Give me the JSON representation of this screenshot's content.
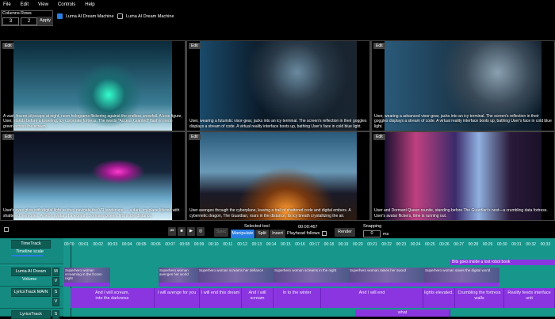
{
  "menu": [
    "File",
    "Edit",
    "View",
    "Controls",
    "Help"
  ],
  "grid_controls": {
    "columns_label": "Columns",
    "rows_label": "Rows",
    "columns": "3",
    "rows": "2",
    "apply": "Apply"
  },
  "checkboxes": [
    {
      "label": "Luma AI Dream Machine",
      "checked": true
    },
    {
      "label": "Luma AI Dream Machine",
      "checked": false
    }
  ],
  "cells": [
    {
      "edit": "Edit",
      "caption": "A vast, frozen cityscape at night, neon holograms flickering against the endless snowfall. A lone figure, User, stands before a towering, icy corporate fortress. The words \"Access Granted\" flash in neon green across the screen."
    },
    {
      "edit": "Edit",
      "caption": "User, wearing a futuristic visor-gear, jacks into an icy terminal. The screen's reflection in their goggles displays a stream of code. A virtual reality interface boots up, bathing User's face in cold blue light."
    },
    {
      "edit": "Edit",
      "caption": "User, wearing a advanced visor-gear, jacks into an icy terminal. The screen's reflection in their goggles displays a stream of code. A virtual reality interface boots up, bathing User's face in cold blue light."
    },
    {
      "edit": "Edit",
      "caption": "User's eyes glow with digital light as they navigate the VR landscape — a dark, icy plane littered with shattered memories. A neon avatar of a woman, Dormant Queen, lifts in the distance."
    },
    {
      "edit": "Edit",
      "caption": "User avenges through the cyberplane, leaving a trail of shattered code and digital embers. A cybernetic dragon, The Guardian, roars in the distance, its icy breath crystallizing the air."
    },
    {
      "edit": "Edit",
      "caption": "User and Dormant Queen reunite, standing before The Guardian's nest—a crumbling data fortress. User's avatar flickers, time is running out."
    }
  ],
  "transport": {
    "selected_tool_label": "Selected tool",
    "time": "00:00:467",
    "sync": "Sync",
    "manipulate": "Manipulate",
    "split": "Split",
    "insert": "Insert",
    "playhead_follows": "Playhead follows",
    "render": "Render",
    "snapping_label": "Snapping",
    "snapping_value": "0",
    "snapping_unit": "ms"
  },
  "tracks": {
    "time": "TimeTrack",
    "timeline_scale": "Timeline scale",
    "video": "Luma AI Dream",
    "volume": "Volume",
    "lyrics_main": "LyricsTrack MAIN",
    "lyrics2": "LyricsTrack",
    "m": "M",
    "v": "V",
    "s": "S"
  },
  "ticks": [
    "00:00",
    "00:01",
    "00:02",
    "00:03",
    "00:04",
    "00:05",
    "00:06",
    "00:07",
    "00:08",
    "00:09",
    "00:10",
    "00:11",
    "00:12",
    "00:13",
    "00:14",
    "00:15",
    "00:16",
    "00:17",
    "00:18",
    "00:19",
    "00:20",
    "00:21",
    "00:22",
    "00:23",
    "00:24",
    "00:25",
    "00:26",
    "00:27",
    "00:28",
    "00:29",
    "00:30",
    "00:31",
    "00:32",
    "00:33"
  ],
  "video_clips": [
    "Superhero woman screaming in the frozen night",
    "Superhero woman avenges her world",
    "Superhero woman screams her defiance",
    "Superhero woman screams in the night",
    "Superhero woman raises her sword",
    "Superhero woman saves the digital world"
  ],
  "lyrics": [
    "And I will scream,\ninto the darkness",
    "I will avenge for you",
    "I will end this dream",
    "And I will scream",
    "In to the winter",
    "And I will end",
    "lights elevated.",
    "Crumbling the fortress walls",
    "Reality feeds interface unit"
  ],
  "lyrics2": [
    "what"
  ],
  "overlay_note": "Bits goes inside a lost robot book"
}
